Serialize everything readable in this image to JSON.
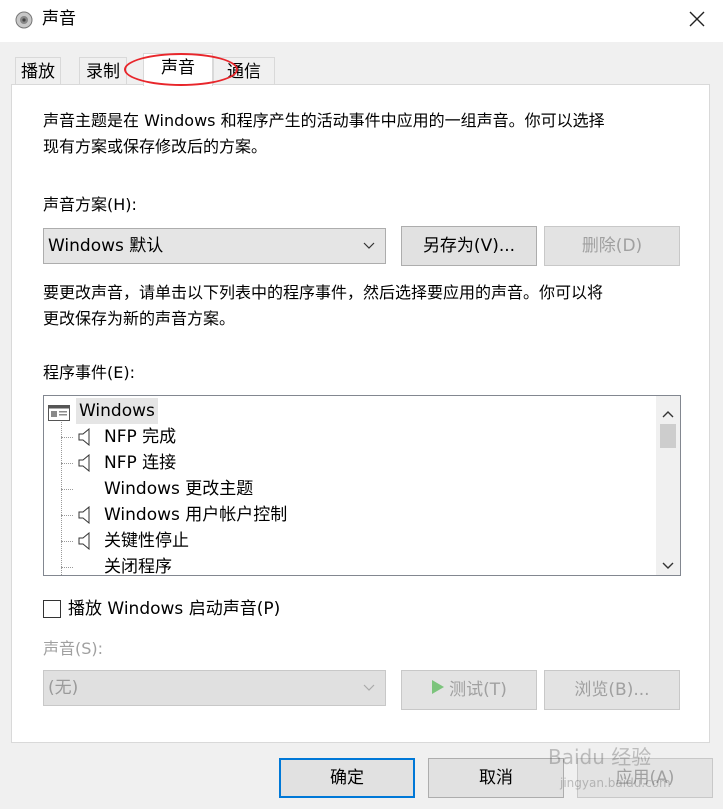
{
  "window": {
    "title": "声音"
  },
  "tabs": [
    {
      "label": "播放"
    },
    {
      "label": "录制"
    },
    {
      "label": "声音"
    },
    {
      "label": "通信"
    }
  ],
  "intro_text_line1": "声音主题是在 Windows 和程序产生的活动事件中应用的一组声音。你可以选择",
  "intro_text_line2": "现有方案或保存修改后的方案。",
  "scheme": {
    "label": "声音方案(H):",
    "selected": "Windows 默认",
    "save_as_label": "另存为(V)...",
    "delete_label": "删除(D)"
  },
  "change_text_line1": "要更改声音，请单击以下列表中的程序事件，然后选择要应用的声音。你可以将",
  "change_text_line2": "更改保存为新的声音方案。",
  "events": {
    "label": "程序事件(E):",
    "items": [
      {
        "label": "Windows",
        "icon": "window-icon",
        "level": 0
      },
      {
        "label": "NFP 完成",
        "icon": "speaker-icon",
        "level": 1
      },
      {
        "label": "NFP 连接",
        "icon": "speaker-icon",
        "level": 1
      },
      {
        "label": "Windows 更改主题",
        "icon": "",
        "level": 1
      },
      {
        "label": "Windows 用户帐户控制",
        "icon": "speaker-icon",
        "level": 1
      },
      {
        "label": "关键性停止",
        "icon": "speaker-icon",
        "level": 1
      },
      {
        "label": "关闭程序",
        "icon": "",
        "level": 1
      }
    ]
  },
  "startup_sound_label": "播放 Windows 启动声音(P)",
  "sound": {
    "label": "声音(S):",
    "selected": "(无)",
    "test_label": "测试(T)",
    "browse_label": "浏览(B)..."
  },
  "footer": {
    "ok_label": "确定",
    "cancel_label": "取消",
    "apply_label": "应用(A)"
  },
  "watermark": {
    "text": "Baidu 经验",
    "sub": "jingyan.baidu.com"
  },
  "colors": {
    "highlight_oval": "#e8262b",
    "focus_blue": "#0078d7"
  }
}
